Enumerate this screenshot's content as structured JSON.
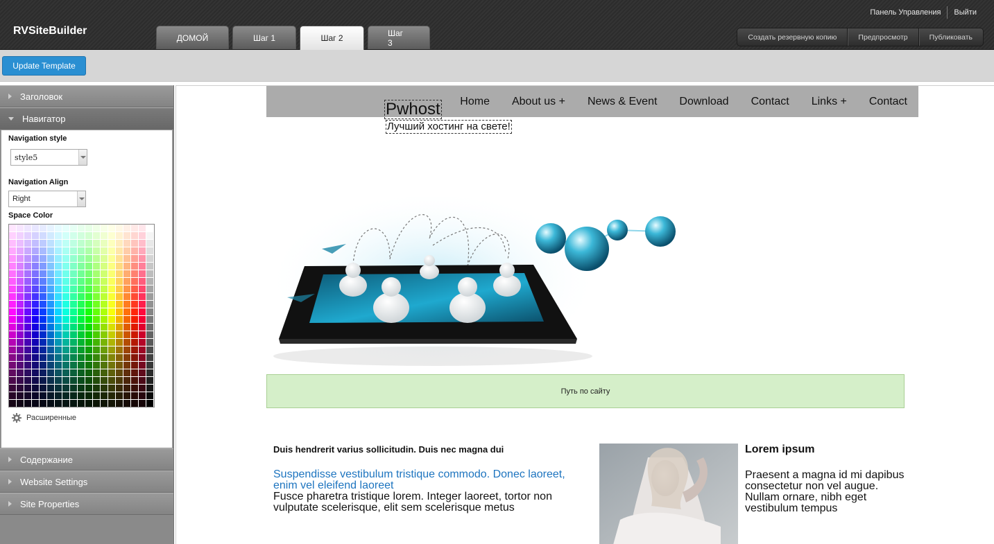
{
  "app": {
    "title": "RVSiteBuilder"
  },
  "header": {
    "links": [
      "Панель Управления",
      "Выйти"
    ],
    "step_tabs": [
      {
        "label": "ДОМОЙ",
        "active": false
      },
      {
        "label": "Шаг 1",
        "active": false
      },
      {
        "label": "Шаг 2",
        "active": true
      },
      {
        "label": "Шаг 3",
        "active": false
      }
    ],
    "actions": [
      "Создать резервную копию",
      "Предпросмотр",
      "Публиковать"
    ]
  },
  "toolbar": {
    "update_label": "Update Template"
  },
  "sidebar": {
    "sections": [
      "Заголовок",
      "Навигатор",
      "Содержание",
      "Website Settings",
      "Site Properties"
    ],
    "navigator": {
      "style_label": "Navigation style",
      "style_value": "style5",
      "align_label": "Navigation Align",
      "align_value": "Right",
      "color_label": "Space Color",
      "advanced_label": "Расширенные"
    }
  },
  "preview": {
    "nav_items": [
      "Home",
      "About us +",
      "News & Event",
      "Download",
      "Contact",
      "Links +",
      "Contact"
    ],
    "site_title": "Pwhost",
    "slogan": "Лучший хостинг на свете!",
    "breadcrumb": "Путь по сайту",
    "col1": {
      "heading": "Duis hendrerit varius sollicitudin. Duis nec magna dui",
      "link": "Suspendisse vestibulum tristique commodo. Donec laoreet, enim vel eleifend laoreet",
      "text": "Fusce pharetra tristique lorem. Integer laoreet, tortor non vulputate scelerisque, elit sem scelerisque metus"
    },
    "col2": {
      "heading": "Lorem ipsum",
      "text": "Praesent a magna id mi dapibus consectetur non vel augue. Nullam ornare, nibh eget vestibulum tempus"
    }
  },
  "colors": {
    "accent": "#2a8fd2",
    "breadcrumb_bg": "#d5efc9",
    "nav_bg": "#ababab",
    "link": "#1d74bf"
  }
}
